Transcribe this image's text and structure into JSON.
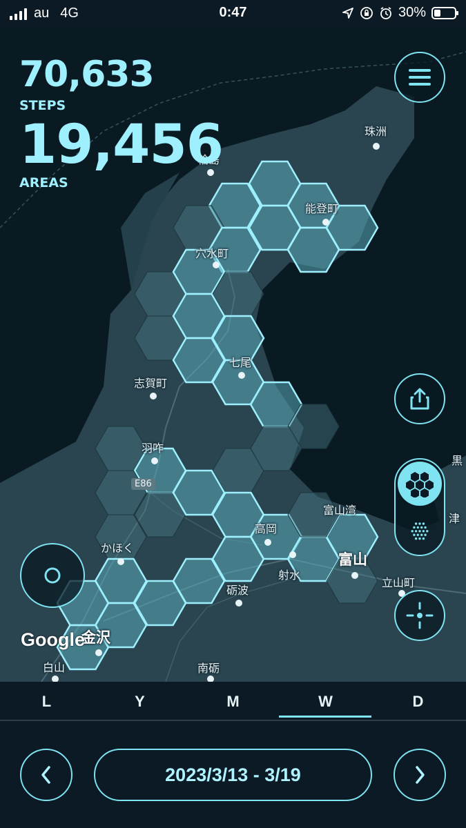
{
  "status_bar": {
    "carrier": "au",
    "network": "4G",
    "time": "0:47",
    "battery": "30%"
  },
  "stats": {
    "steps_value": "70,633",
    "steps_label": "STEPS",
    "areas_value": "19,456",
    "areas_label": "AREAS"
  },
  "map": {
    "places": {
      "suzu": "珠洲",
      "wajima": "輪島",
      "noto": "能登町",
      "anamizu": "穴水町",
      "nanao": "七尾",
      "shika": "志賀町",
      "hakui": "羽咋",
      "toyama_bay": "富山湾",
      "takaoka": "高岡",
      "toyama": "富山",
      "imizu": "射水",
      "tateyama": "立山町",
      "kahoku": "かほく",
      "tonami": "砺波",
      "kanazawa": "金沢",
      "hakusan": "白山",
      "nanto": "南砺",
      "kuro": "黒",
      "tsu": "津"
    },
    "road_badge": "E86",
    "attribution": "Google"
  },
  "tabs": [
    {
      "label": "L"
    },
    {
      "label": "Y"
    },
    {
      "label": "M"
    },
    {
      "label": "W",
      "selected": true
    },
    {
      "label": "D"
    }
  ],
  "date_range": "2023/3/13 - 3/19",
  "icons": {
    "menu": "menu-icon",
    "share": "share-icon",
    "hex_mode": "hex-cluster-icon",
    "dot_mode": "dots-cluster-icon",
    "locate": "crosshair-icon",
    "record": "record-circle-icon",
    "prev": "chevron-left-icon",
    "next": "chevron-right-icon"
  },
  "colors": {
    "accent": "#7fe3f2",
    "hex_fill": "#3f7e8a",
    "background": "#0b1a24"
  }
}
